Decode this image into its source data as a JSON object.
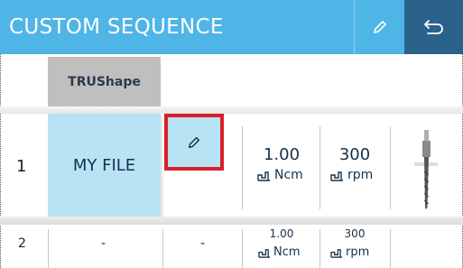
{
  "header": {
    "title": "CUSTOM SEQUENCE",
    "edit_icon": "pencil-icon",
    "back_icon": "return-arrow-icon",
    "background": "#4fb5e6",
    "back_background": "#2b628c"
  },
  "table": {
    "column_header": "TRUShape",
    "rows": [
      {
        "index": "1",
        "file": "MY FILE",
        "edit_icon": "pencil-icon",
        "torque_value": "1.00",
        "torque_unit": "Ncm",
        "speed_value": "300",
        "speed_unit": "rpm",
        "instrument_icon": "endodontic-file-icon"
      },
      {
        "index": "2",
        "file": "-",
        "edit": "-",
        "torque_value": "1.00",
        "torque_unit": "Ncm",
        "speed_value": "300",
        "speed_unit": "rpm"
      }
    ]
  },
  "colors": {
    "selected_cell": "#b8e3f5",
    "highlight_border": "#d6202a"
  }
}
